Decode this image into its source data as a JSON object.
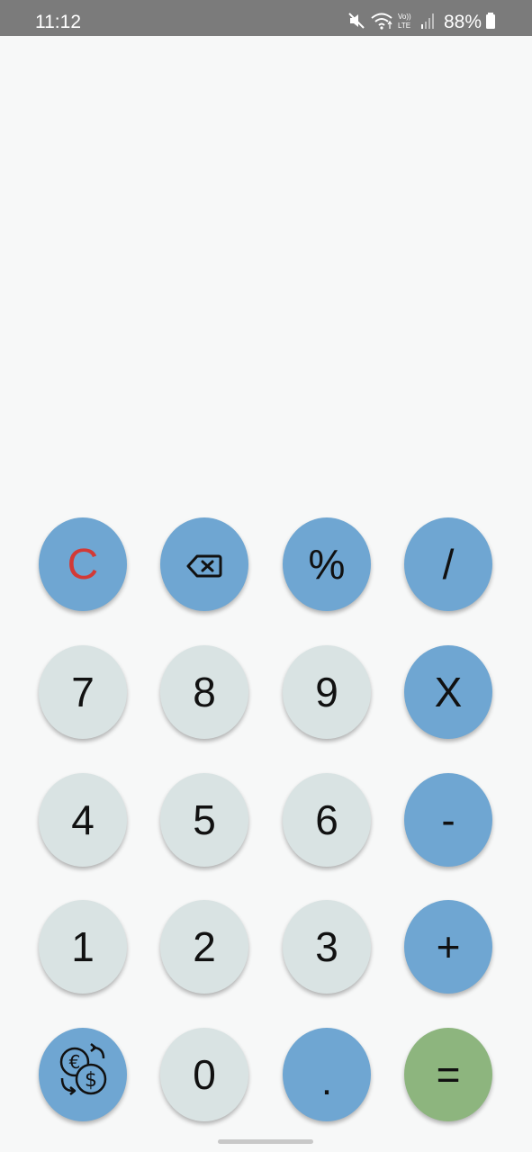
{
  "status_bar": {
    "time": "11:12",
    "battery": "88%",
    "icons": [
      "mute-icon",
      "wifi-icon",
      "volte-lte-icon",
      "signal-icon",
      "battery-icon"
    ]
  },
  "display": {
    "expression": "",
    "result": ""
  },
  "keypad": {
    "clear": "C",
    "backspace_icon": "backspace-icon",
    "percent": "%",
    "divide": "/",
    "seven": "7",
    "eight": "8",
    "nine": "9",
    "multiply": "X",
    "four": "4",
    "five": "5",
    "six": "6",
    "minus": "-",
    "one": "1",
    "two": "2",
    "three": "3",
    "plus": "+",
    "currency_icon": "currency-exchange-icon",
    "zero": "0",
    "decimal": ".",
    "equals": "="
  },
  "colors": {
    "operator": "#6fa6d2",
    "digit": "#d9e3e3",
    "equals": "#8db57e",
    "clear_text": "#d33a36",
    "background": "#f7f8f8",
    "status_bar": "#7b7b7b"
  }
}
